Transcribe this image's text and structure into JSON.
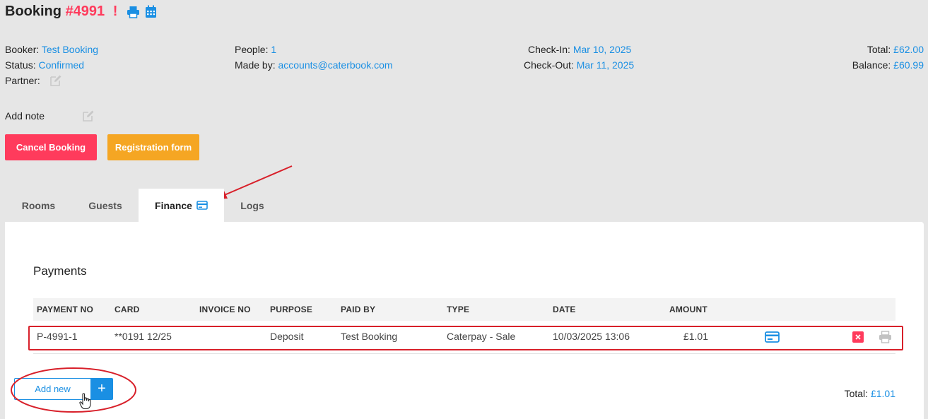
{
  "header": {
    "title_prefix": "Booking",
    "booking_number": "#4991",
    "alert_mark": "!",
    "print_icon": "print-icon",
    "calendar_icon": "calendar-icon"
  },
  "details": {
    "booker_label": "Booker:",
    "booker_value": "Test Booking",
    "status_label": "Status:",
    "status_value": "Confirmed",
    "partner_label": "Partner:",
    "people_label": "People:",
    "people_value": "1",
    "made_by_label": "Made by:",
    "made_by_value": "accounts@caterbook.com",
    "check_in_label": "Check-In:",
    "check_in_value": "Mar 10, 2025",
    "check_out_label": "Check-Out:",
    "check_out_value": "Mar 11, 2025",
    "total_label": "Total:",
    "total_value": "£62.00",
    "balance_label": "Balance:",
    "balance_value": "£60.99"
  },
  "note": {
    "label": "Add note"
  },
  "actions": {
    "cancel_label": "Cancel Booking",
    "cancel_color": "#ff3b5c",
    "registration_label": "Registration form",
    "registration_color": "#f5a623"
  },
  "tabs": [
    {
      "label": "Rooms"
    },
    {
      "label": "Guests"
    },
    {
      "label": "Finance"
    },
    {
      "label": "Logs"
    }
  ],
  "payments": {
    "title": "Payments",
    "columns": [
      "PAYMENT NO",
      "CARD",
      "INVOICE NO",
      "PURPOSE",
      "PAID BY",
      "TYPE",
      "DATE",
      "AMOUNT"
    ],
    "rows": [
      {
        "payment_no": "P-4991-1",
        "card": "**0191 12/25",
        "invoice_no": "",
        "purpose": "Deposit",
        "paid_by": "Test Booking",
        "type": "Caterpay - Sale",
        "date": "10/03/2025 13:06",
        "amount": "£1.01"
      }
    ],
    "add_new_label": "Add new",
    "add_new_plus": "+",
    "total_label": "Total:",
    "total_value": "£1.01"
  },
  "colors": {
    "accent": "#1a8fe3",
    "danger": "#ff3b5c",
    "warning": "#f5a623",
    "annotation": "#d8202a"
  }
}
